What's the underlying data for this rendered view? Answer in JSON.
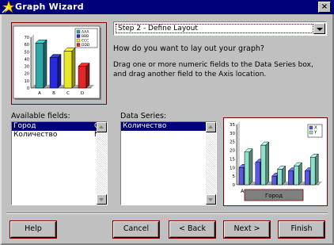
{
  "window": {
    "title": "Graph Wizard",
    "close_label": "×"
  },
  "step_select": {
    "selected": "Step 2 - Define Layout"
  },
  "question": "How do you want to lay out your graph?",
  "instructions": "Drag one or more numeric fields to the Data Series box, and drag another field to the Axis location.",
  "available_fields": {
    "label": "Available fields:",
    "items": [
      {
        "name": "Город",
        "type": "C",
        "selected": true
      },
      {
        "name": "Количество",
        "type": "N",
        "selected": false
      }
    ]
  },
  "data_series": {
    "label": "Data Series:",
    "items": [
      {
        "name": "Количество",
        "selected": true
      }
    ]
  },
  "preview_thumbnail": {
    "y_ticks": [
      "70",
      "60",
      "50",
      "40",
      "30",
      "20",
      "10",
      "0"
    ],
    "categories": [
      "A",
      "B",
      "C",
      "D"
    ],
    "legend": [
      "AAA",
      "BBB",
      "CCC",
      "DDD"
    ],
    "values": [
      62,
      42,
      51,
      30
    ],
    "colors": [
      "#2ea6a6",
      "#2929e0",
      "#e8e82a",
      "#e02626"
    ]
  },
  "chart_data": {
    "type": "bar",
    "categories": [
      "A",
      "",
      "",
      "",
      ""
    ],
    "series": [
      {
        "name": "X",
        "values": [
          10,
          13,
          5,
          8,
          8
        ]
      },
      {
        "name": "Y",
        "values": [
          19,
          23,
          9,
          11,
          16
        ]
      }
    ],
    "y_ticks": [
      "35",
      "30",
      "25",
      "20",
      "15",
      "10",
      "5",
      "0"
    ],
    "ylim": [
      0,
      35
    ],
    "axis_field": "Город",
    "colors": {
      "X": "#5a5ae0",
      "Y": "#8fe0c8"
    },
    "legend_position": "top-right"
  },
  "buttons": {
    "help": "Help",
    "cancel": "Cancel",
    "back": "< Back",
    "next": "Next >",
    "finish": "Finish"
  }
}
